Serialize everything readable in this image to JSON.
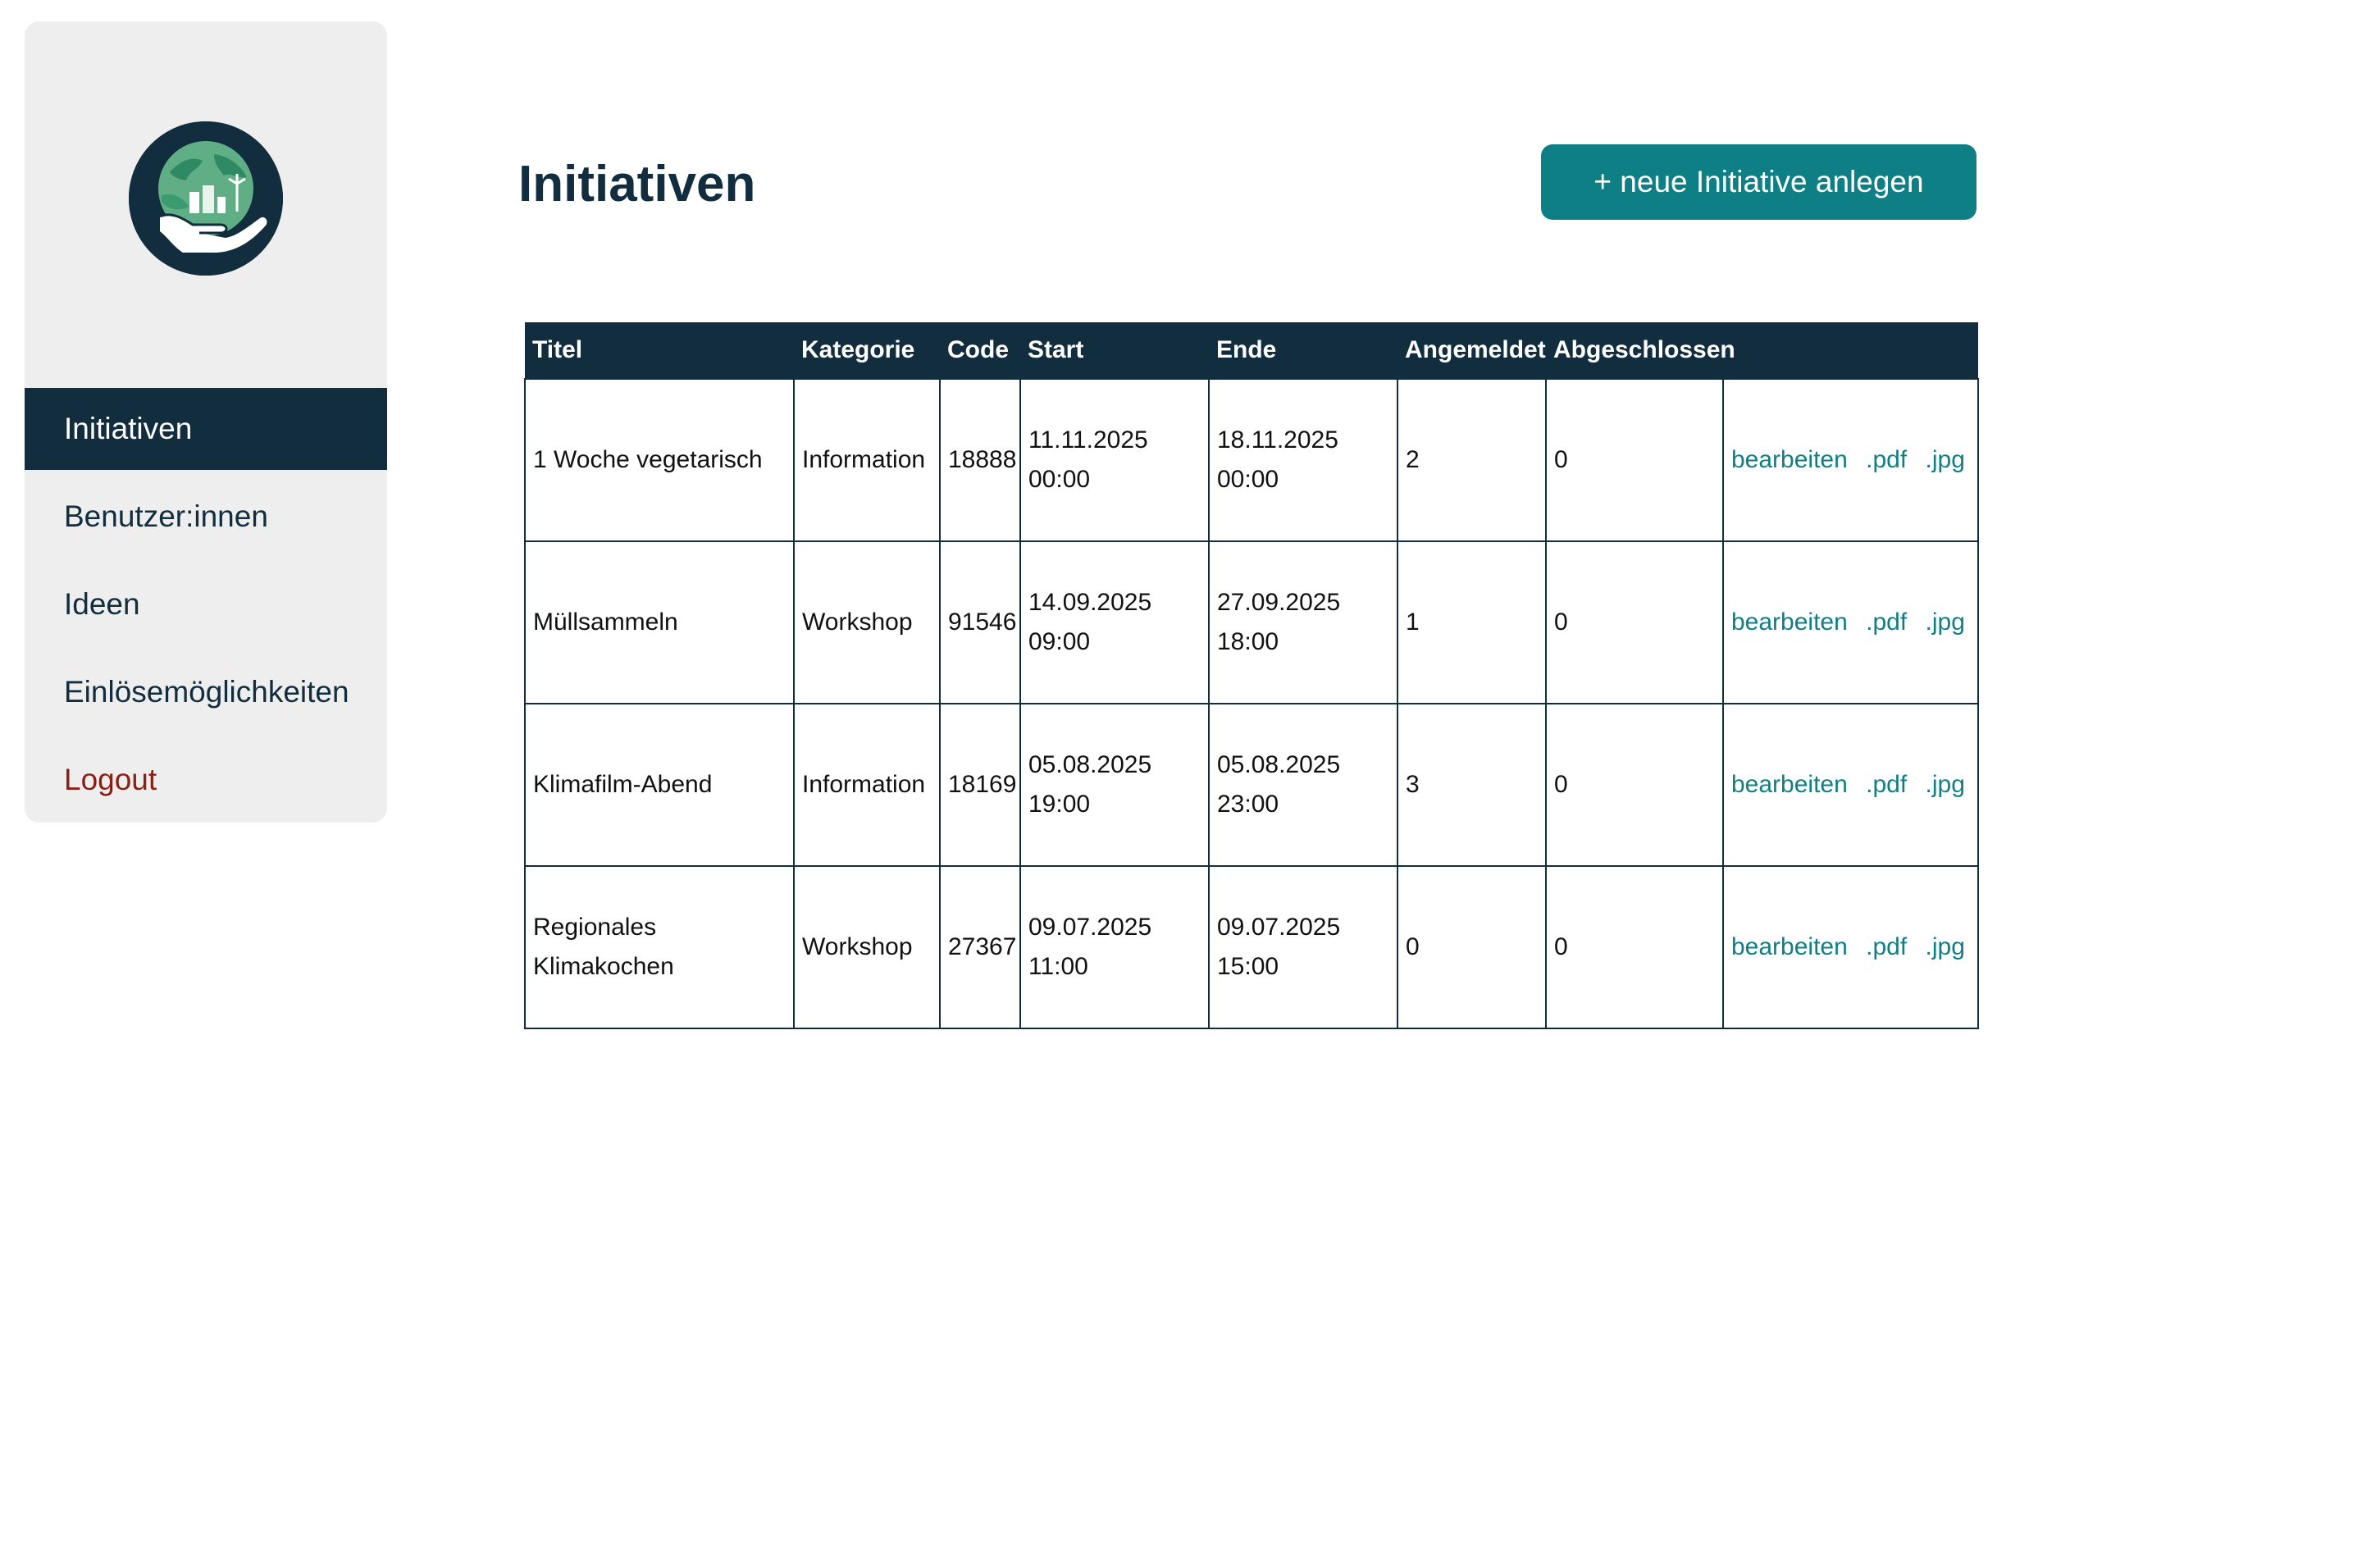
{
  "sidebar": {
    "logo_icon": "globe-in-hand-icon",
    "items": [
      {
        "label": "Initiativen",
        "active": true
      },
      {
        "label": "Benutzer:innen"
      },
      {
        "label": "Ideen"
      },
      {
        "label": "Einlösemöglichkeiten"
      },
      {
        "label": "Logout"
      }
    ]
  },
  "main": {
    "title": "Initiativen",
    "add_button_label": "+ neue Initiative anlegen"
  },
  "table": {
    "headers": [
      "Titel",
      "Kategorie",
      "Code",
      "Start",
      "Ende",
      "Angemeldet",
      "Abgeschlossen",
      ""
    ],
    "rows": [
      {
        "titel": "1 Woche vegetarisch",
        "kategorie": "Information",
        "code": "18888",
        "start_date": "11.11.2025",
        "start_time": "00:00",
        "ende_date": "18.11.2025",
        "ende_time": "00:00",
        "angemeldet": "2",
        "abgeschlossen": "0"
      },
      {
        "titel": "Müllsammeln",
        "kategorie": "Workshop",
        "code": "91546",
        "start_date": "14.09.2025",
        "start_time": "09:00",
        "ende_date": "27.09.2025",
        "ende_time": "18:00",
        "angemeldet": "1",
        "abgeschlossen": "0"
      },
      {
        "titel": "Klimafilm-Abend",
        "kategorie": "Information",
        "code": "18169",
        "start_date": "05.08.2025",
        "start_time": "19:00",
        "ende_date": "05.08.2025",
        "ende_time": "23:00",
        "angemeldet": "3",
        "abgeschlossen": "0"
      },
      {
        "titel": "Regionales Klimakochen",
        "kategorie": "Workshop",
        "code": "27367",
        "start_date": "09.07.2025",
        "start_time": "11:00",
        "ende_date": "09.07.2025",
        "ende_time": "15:00",
        "angemeldet": "0",
        "abgeschlossen": "0"
      }
    ],
    "actions": {
      "edit": "bearbeiten",
      "pdf": ".pdf",
      "jpg": ".jpg"
    }
  },
  "colors": {
    "primary": "#112d3e",
    "accent": "#0e7f85",
    "sidebar_bg": "#eeeeee",
    "logout": "#8a1f14"
  }
}
